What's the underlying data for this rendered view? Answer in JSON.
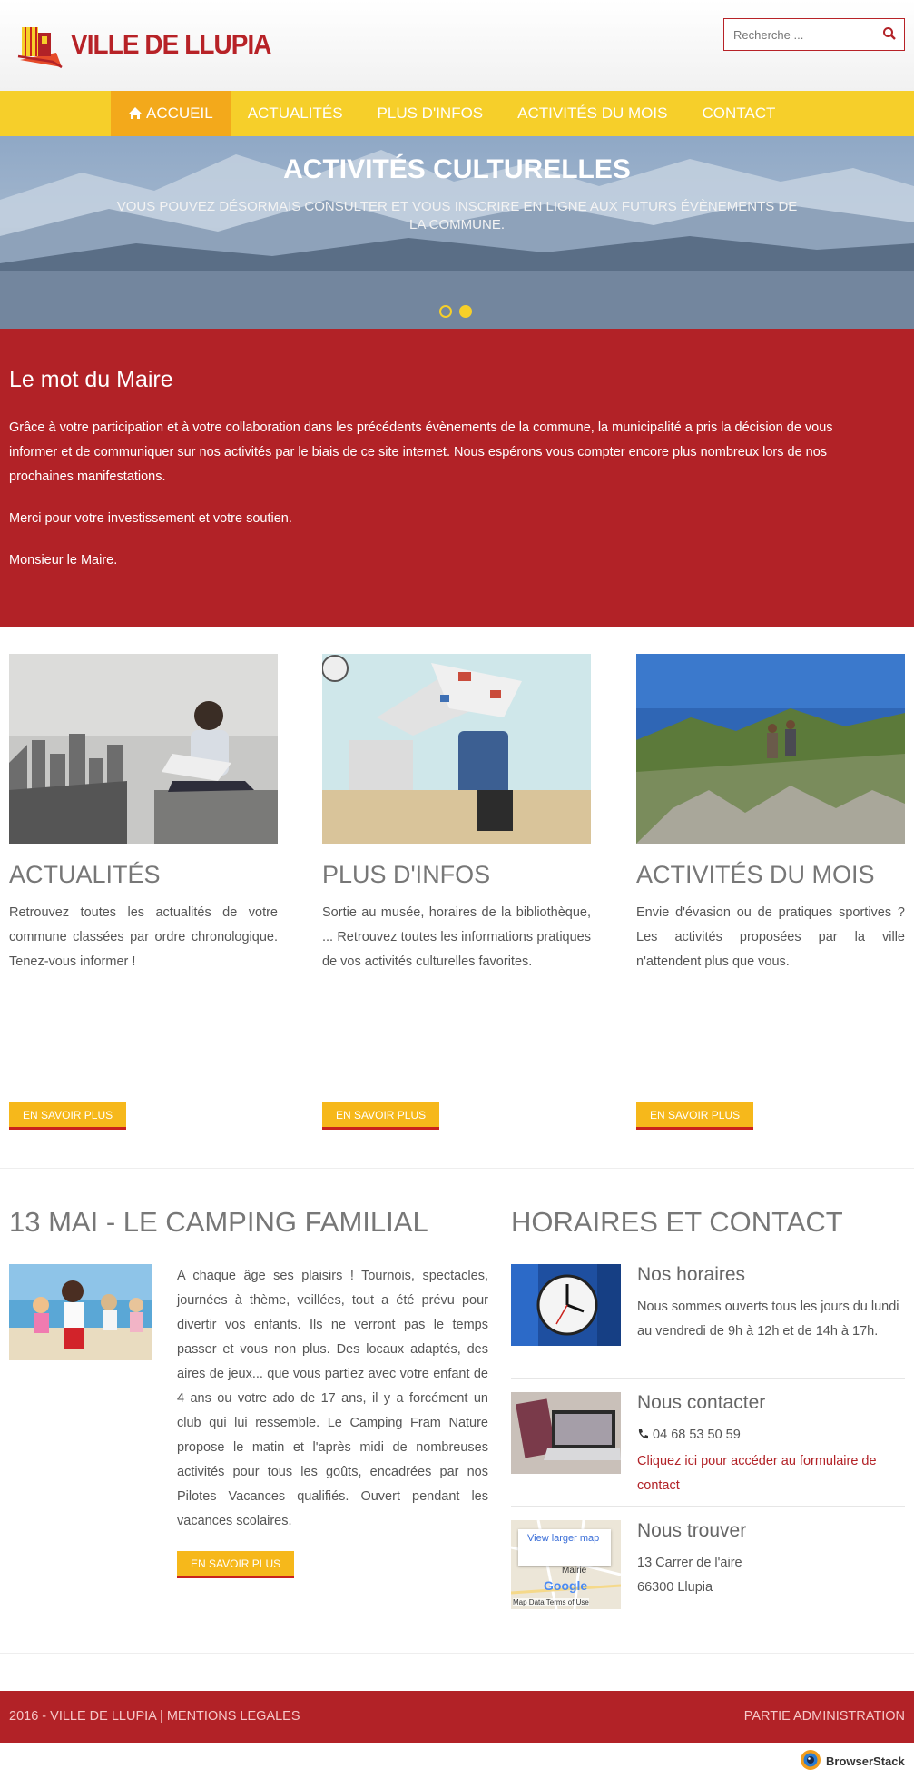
{
  "colors": {
    "brand_red": "#b22227",
    "nav_yellow": "#f6cf2a",
    "nav_active": "#f3a91b",
    "button": "#f6b81b"
  },
  "header": {
    "logo_text": "VILLE DE LLUPIA",
    "search_placeholder": "Recherche ...",
    "search_icon": "search-icon"
  },
  "nav": {
    "items": [
      {
        "label": "ACCUEIL",
        "icon": "home-icon",
        "active": true
      },
      {
        "label": "ACTUALITÉS"
      },
      {
        "label": "PLUS D'INFOS"
      },
      {
        "label": "ACTIVITÉS DU MOIS"
      },
      {
        "label": "CONTACT"
      }
    ]
  },
  "hero": {
    "title": "ACTIVITÉS CULTURELLES",
    "subtitle": "VOUS POUVEZ DÉSORMAIS CONSULTER ET VOUS INSCRIRE EN LIGNE AUX FUTURS ÉVÈNEMENTS DE LA COMMUNE.",
    "slide_count": 2,
    "active_slide": 2
  },
  "mayor": {
    "title": "Le mot du Maire",
    "p1": "Grâce à votre participation et à votre collaboration dans les précédents évènements de la commune, la municipalité a pris la décision de vous informer et de communiquer sur nos activités par le biais de ce site internet. Nous espérons vous compter encore plus nombreux lors de nos prochaines manifestations.",
    "p2": "Merci pour votre investissement et votre soutien.",
    "p3": "Monsieur le Maire."
  },
  "features": [
    {
      "title": "ACTUALITÉS",
      "text": "Retrouvez toutes les actualités de votre commune classées par ordre chronologique. Tenez-vous informer !",
      "button": "EN SAVOIR PLUS"
    },
    {
      "title": "PLUS D'INFOS",
      "text": "Sortie au musée, horaires de la bibliothèque, ... Retrouvez toutes les informations pratiques de vos activités culturelles favorites.",
      "button": "EN SAVOIR PLUS"
    },
    {
      "title": "ACTIVITÉS DU MOIS",
      "text": "Envie d'évasion ou de pratiques sportives ? Les activités proposées par la ville n'attendent plus que vous.",
      "button": "EN SAVOIR PLUS"
    }
  ],
  "camping": {
    "title": "13 MAI - LE CAMPING FAMILIAL",
    "text": "A chaque âge ses plaisirs ! Tournois, spectacles, journées à thème, veillées, tout a été prévu pour divertir vos enfants. Ils ne verront pas le temps passer et vous non plus. Des locaux adaptés, des aires de jeux... que vous partiez avec votre enfant de 4 ans ou votre ado de 17 ans, il y a forcément un club qui lui ressemble. Le Camping Fram Nature propose le matin et l'après midi de nombreuses activités pour tous les goûts, encadrées par nos Pilotes Vacances qualifiés. Ouvert pendant les vacances scolaires.",
    "button": "EN SAVOIR PLUS"
  },
  "contact": {
    "title": "HORAIRES ET CONTACT",
    "hours": {
      "title": "Nos horaires",
      "text": "Nous sommes ouverts tous les jours du lundi au vendredi de 9h à 12h et de 14h à 17h."
    },
    "reach": {
      "title": "Nous contacter",
      "phone": "04 68 53 50 59",
      "link": "Cliquez ici pour accéder au formulaire de contact"
    },
    "find": {
      "title": "Nous trouver",
      "address1": "13 Carrer de l'aire",
      "address2": "66300 Llupia",
      "map_link": "View larger map",
      "map_terms": "Map Data  Terms of Use",
      "map_brand": "Google",
      "map_label": "Mairie"
    }
  },
  "footer": {
    "left": "2016 - VILLE DE LLUPIA | MENTIONS LEGALES",
    "right": "PARTIE ADMINISTRATION"
  },
  "badge": {
    "label": "BrowserStack"
  }
}
